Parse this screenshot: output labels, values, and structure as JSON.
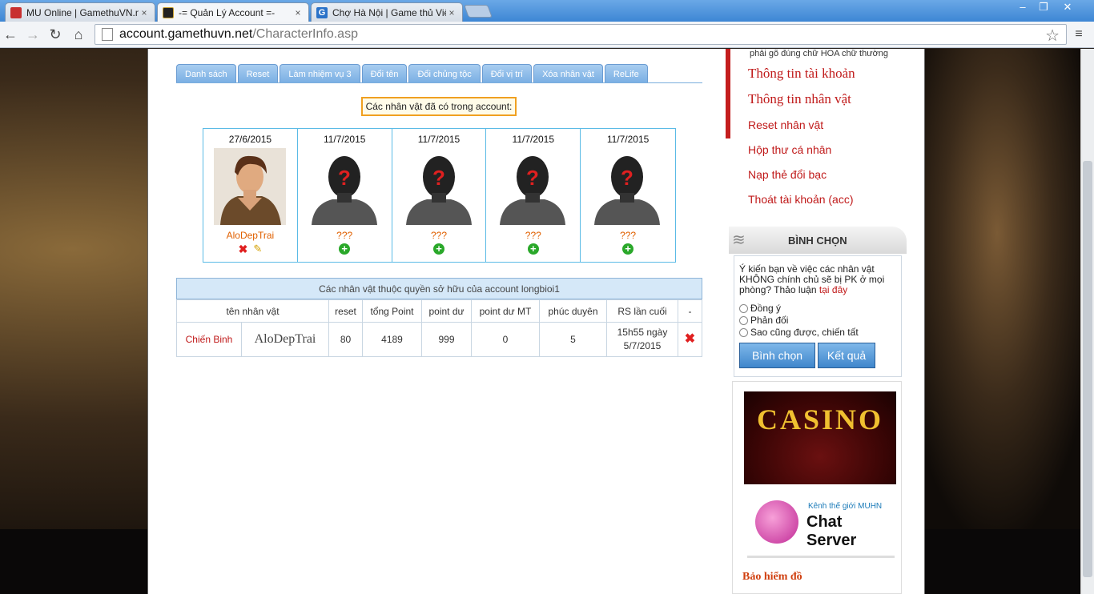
{
  "browser": {
    "tabs": [
      {
        "title": "MU Online | GamethuVN.net",
        "close": "×"
      },
      {
        "title": "-= Quản Lý Account =-",
        "close": "×"
      },
      {
        "title": "Chợ Hà Nội | Game thủ Việt N",
        "close": "×"
      }
    ],
    "url_host": "account.gamethuvn.net",
    "url_path": "/CharacterInfo.asp",
    "window_buttons": [
      "‒",
      "❐",
      "✕"
    ]
  },
  "page": {
    "tabs": [
      "Danh sách",
      "Reset",
      "Làm nhiệm vụ 3",
      "Đổi tên",
      "Đổi chủng tộc",
      "Đổi vị trí",
      "Xóa nhân vật",
      "ReLife"
    ],
    "account_box": "Các nhân vật đã có trong account:",
    "characters": [
      {
        "date": "27/6/2015",
        "name": "AloDepTrai",
        "filled": true
      },
      {
        "date": "11/7/2015",
        "name": "???",
        "filled": false
      },
      {
        "date": "11/7/2015",
        "name": "???",
        "filled": false
      },
      {
        "date": "11/7/2015",
        "name": "???",
        "filled": false
      },
      {
        "date": "11/7/2015",
        "name": "???",
        "filled": false
      }
    ],
    "owned_title": "Các nhân vật thuộc quyền sở hữu của account longbioi1",
    "table_headers": [
      "tên nhân vật",
      "reset",
      "tổng Point",
      "point dư",
      "point dư MT",
      "phúc duyên",
      "RS lần cuối",
      "-"
    ],
    "table_rows": [
      {
        "class": "Chiến Binh",
        "name": "AloDepTrai",
        "reset": "80",
        "total_point": "4189",
        "point_du": "999",
        "point_du_mt": "0",
        "phuc_duyen": "5",
        "rs_last": "15h55 ngày 5/7/2015"
      }
    ]
  },
  "sidebar": {
    "hint": "phải gõ đúng chữ HOA chữ thường",
    "menu_big": [
      "Thông tin tài khoản",
      "Thông tin nhân vật"
    ],
    "menu_small": [
      "Reset nhân vật",
      "Hộp thư cá nhân",
      "Nạp thẻ đổi bạc",
      "Thoát tài khoản (acc)"
    ],
    "vote_title": "BÌNH CHỌN",
    "vote_question": "Ý kiến bạn về việc các nhân vật KHÔNG chính chủ sẽ bị PK ở mọi phòng? Thảo luận",
    "vote_link": "tại đây",
    "vote_options": [
      "Đồng ý",
      "Phản đối",
      "Sao cũng được, chiến tất"
    ],
    "vote_button": "Bình chọn",
    "result_button": "Kết quả",
    "casino_text": "CASINO",
    "chat_ad_small": "Kênh thế giới MUHN",
    "chat_ad_big": "Chat Server",
    "insurance_text": "Bảo hiểm đồ"
  }
}
